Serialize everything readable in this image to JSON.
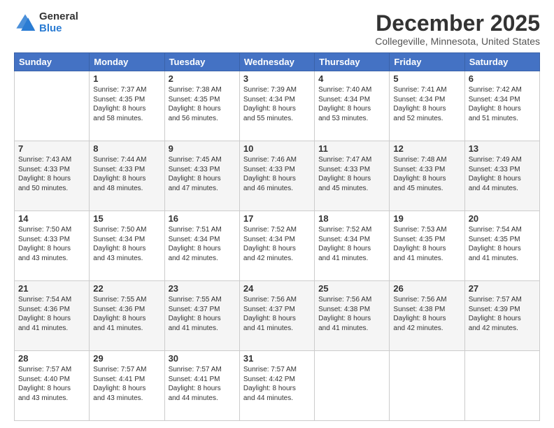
{
  "logo": {
    "general": "General",
    "blue": "Blue"
  },
  "header": {
    "title": "December 2025",
    "subtitle": "Collegeville, Minnesota, United States"
  },
  "days_of_week": [
    "Sunday",
    "Monday",
    "Tuesday",
    "Wednesday",
    "Thursday",
    "Friday",
    "Saturday"
  ],
  "weeks": [
    [
      {
        "day": "",
        "sunrise": "",
        "sunset": "",
        "daylight": ""
      },
      {
        "day": "1",
        "sunrise": "Sunrise: 7:37 AM",
        "sunset": "Sunset: 4:35 PM",
        "daylight": "Daylight: 8 hours and 58 minutes."
      },
      {
        "day": "2",
        "sunrise": "Sunrise: 7:38 AM",
        "sunset": "Sunset: 4:35 PM",
        "daylight": "Daylight: 8 hours and 56 minutes."
      },
      {
        "day": "3",
        "sunrise": "Sunrise: 7:39 AM",
        "sunset": "Sunset: 4:34 PM",
        "daylight": "Daylight: 8 hours and 55 minutes."
      },
      {
        "day": "4",
        "sunrise": "Sunrise: 7:40 AM",
        "sunset": "Sunset: 4:34 PM",
        "daylight": "Daylight: 8 hours and 53 minutes."
      },
      {
        "day": "5",
        "sunrise": "Sunrise: 7:41 AM",
        "sunset": "Sunset: 4:34 PM",
        "daylight": "Daylight: 8 hours and 52 minutes."
      },
      {
        "day": "6",
        "sunrise": "Sunrise: 7:42 AM",
        "sunset": "Sunset: 4:34 PM",
        "daylight": "Daylight: 8 hours and 51 minutes."
      }
    ],
    [
      {
        "day": "7",
        "sunrise": "Sunrise: 7:43 AM",
        "sunset": "Sunset: 4:33 PM",
        "daylight": "Daylight: 8 hours and 50 minutes."
      },
      {
        "day": "8",
        "sunrise": "Sunrise: 7:44 AM",
        "sunset": "Sunset: 4:33 PM",
        "daylight": "Daylight: 8 hours and 48 minutes."
      },
      {
        "day": "9",
        "sunrise": "Sunrise: 7:45 AM",
        "sunset": "Sunset: 4:33 PM",
        "daylight": "Daylight: 8 hours and 47 minutes."
      },
      {
        "day": "10",
        "sunrise": "Sunrise: 7:46 AM",
        "sunset": "Sunset: 4:33 PM",
        "daylight": "Daylight: 8 hours and 46 minutes."
      },
      {
        "day": "11",
        "sunrise": "Sunrise: 7:47 AM",
        "sunset": "Sunset: 4:33 PM",
        "daylight": "Daylight: 8 hours and 45 minutes."
      },
      {
        "day": "12",
        "sunrise": "Sunrise: 7:48 AM",
        "sunset": "Sunset: 4:33 PM",
        "daylight": "Daylight: 8 hours and 45 minutes."
      },
      {
        "day": "13",
        "sunrise": "Sunrise: 7:49 AM",
        "sunset": "Sunset: 4:33 PM",
        "daylight": "Daylight: 8 hours and 44 minutes."
      }
    ],
    [
      {
        "day": "14",
        "sunrise": "Sunrise: 7:50 AM",
        "sunset": "Sunset: 4:33 PM",
        "daylight": "Daylight: 8 hours and 43 minutes."
      },
      {
        "day": "15",
        "sunrise": "Sunrise: 7:50 AM",
        "sunset": "Sunset: 4:34 PM",
        "daylight": "Daylight: 8 hours and 43 minutes."
      },
      {
        "day": "16",
        "sunrise": "Sunrise: 7:51 AM",
        "sunset": "Sunset: 4:34 PM",
        "daylight": "Daylight: 8 hours and 42 minutes."
      },
      {
        "day": "17",
        "sunrise": "Sunrise: 7:52 AM",
        "sunset": "Sunset: 4:34 PM",
        "daylight": "Daylight: 8 hours and 42 minutes."
      },
      {
        "day": "18",
        "sunrise": "Sunrise: 7:52 AM",
        "sunset": "Sunset: 4:34 PM",
        "daylight": "Daylight: 8 hours and 41 minutes."
      },
      {
        "day": "19",
        "sunrise": "Sunrise: 7:53 AM",
        "sunset": "Sunset: 4:35 PM",
        "daylight": "Daylight: 8 hours and 41 minutes."
      },
      {
        "day": "20",
        "sunrise": "Sunrise: 7:54 AM",
        "sunset": "Sunset: 4:35 PM",
        "daylight": "Daylight: 8 hours and 41 minutes."
      }
    ],
    [
      {
        "day": "21",
        "sunrise": "Sunrise: 7:54 AM",
        "sunset": "Sunset: 4:36 PM",
        "daylight": "Daylight: 8 hours and 41 minutes."
      },
      {
        "day": "22",
        "sunrise": "Sunrise: 7:55 AM",
        "sunset": "Sunset: 4:36 PM",
        "daylight": "Daylight: 8 hours and 41 minutes."
      },
      {
        "day": "23",
        "sunrise": "Sunrise: 7:55 AM",
        "sunset": "Sunset: 4:37 PM",
        "daylight": "Daylight: 8 hours and 41 minutes."
      },
      {
        "day": "24",
        "sunrise": "Sunrise: 7:56 AM",
        "sunset": "Sunset: 4:37 PM",
        "daylight": "Daylight: 8 hours and 41 minutes."
      },
      {
        "day": "25",
        "sunrise": "Sunrise: 7:56 AM",
        "sunset": "Sunset: 4:38 PM",
        "daylight": "Daylight: 8 hours and 41 minutes."
      },
      {
        "day": "26",
        "sunrise": "Sunrise: 7:56 AM",
        "sunset": "Sunset: 4:38 PM",
        "daylight": "Daylight: 8 hours and 42 minutes."
      },
      {
        "day": "27",
        "sunrise": "Sunrise: 7:57 AM",
        "sunset": "Sunset: 4:39 PM",
        "daylight": "Daylight: 8 hours and 42 minutes."
      }
    ],
    [
      {
        "day": "28",
        "sunrise": "Sunrise: 7:57 AM",
        "sunset": "Sunset: 4:40 PM",
        "daylight": "Daylight: 8 hours and 43 minutes."
      },
      {
        "day": "29",
        "sunrise": "Sunrise: 7:57 AM",
        "sunset": "Sunset: 4:41 PM",
        "daylight": "Daylight: 8 hours and 43 minutes."
      },
      {
        "day": "30",
        "sunrise": "Sunrise: 7:57 AM",
        "sunset": "Sunset: 4:41 PM",
        "daylight": "Daylight: 8 hours and 44 minutes."
      },
      {
        "day": "31",
        "sunrise": "Sunrise: 7:57 AM",
        "sunset": "Sunset: 4:42 PM",
        "daylight": "Daylight: 8 hours and 44 minutes."
      },
      {
        "day": "",
        "sunrise": "",
        "sunset": "",
        "daylight": ""
      },
      {
        "day": "",
        "sunrise": "",
        "sunset": "",
        "daylight": ""
      },
      {
        "day": "",
        "sunrise": "",
        "sunset": "",
        "daylight": ""
      }
    ]
  ]
}
